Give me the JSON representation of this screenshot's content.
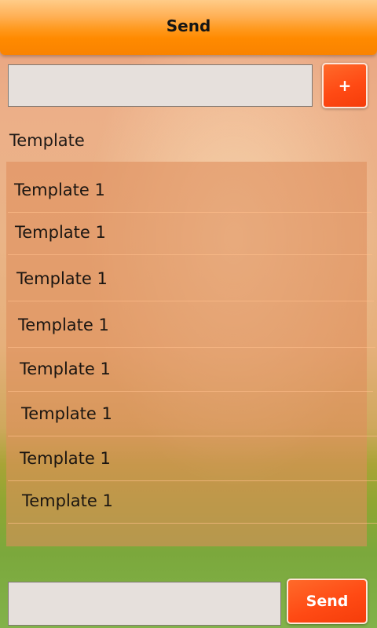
{
  "header": {
    "title": "Send"
  },
  "top_bar": {
    "input_value": "",
    "add_label": "+"
  },
  "section_label": "Template",
  "templates": [
    "Template 1",
    "Template 1",
    "Template 1",
    "Template 1",
    "Template 1",
    "Template 1",
    "Template 1",
    "Template 1"
  ],
  "bottom_bar": {
    "message_value": "",
    "send_label": "Send"
  },
  "colors": {
    "header": "#ff8a00",
    "button": "#ff4a14",
    "input_bg": "#e6e0dc"
  }
}
